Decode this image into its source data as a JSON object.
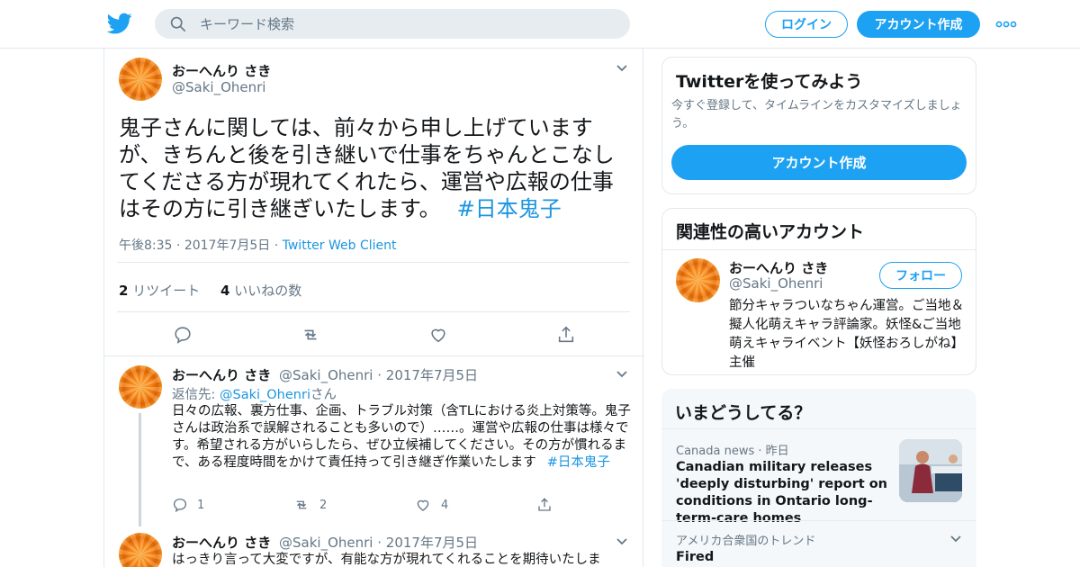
{
  "nav": {
    "search_placeholder": "キーワード検索",
    "login_label": "ログイン",
    "signup_label": "アカウント作成",
    "brand_color": "#1da1f2"
  },
  "main_tweet": {
    "display_name": "おーへんり さき",
    "handle": "@Saki_Ohenri",
    "text": "鬼子さんに関しては、前々から申し上げていますが、きちんと後を引き継いで仕事をちゃんとこなしてくださる方が現れてくれたら、運営や広報の仕事はその方に引き継ぎいたします。",
    "hashtag": "#日本鬼子",
    "time": "午後8:35",
    "date": "2017年7月5日",
    "client": "Twitter Web Client",
    "retweet_count": "2",
    "retweet_label": "リツイート",
    "like_count": "4",
    "like_label": "いいねの数"
  },
  "replies": [
    {
      "display_name": "おーへんり さき",
      "handle": "@Saki_Ohenri",
      "date": "2017年7月5日",
      "reply_to_prefix": "返信先: ",
      "reply_to_mention": "@Saki_Ohenri",
      "reply_to_suffix": "さん",
      "text": "日々の広報、裏方仕事、企画、トラブル対策（含TLにおける炎上対策等。鬼子さんは政治系で誤解されることも多いので）……。運営や広報の仕事は様々です。希望される方がいらしたら、ぜひ立候補してください。その方が慣れるまで、ある程度時間をかけて責任持って引き継ぎ作業いたします",
      "hashtag": "#日本鬼子",
      "reply_count": "1",
      "retweet_count": "2",
      "like_count": "4"
    },
    {
      "display_name": "おーへんり さき",
      "handle": "@Saki_Ohenri",
      "date": "2017年7月5日",
      "text": "はっきり言って大変ですが、有能な方が現れてくれることを期待いたしま"
    }
  ],
  "sidebar": {
    "signup_card": {
      "title": "Twitterを使ってみよう",
      "subtitle": "今すぐ登録して、タイムラインをカスタマイズしましょう。",
      "button": "アカウント作成"
    },
    "related_card": {
      "title": "関連性の高いアカウント",
      "display_name": "おーへんり さき",
      "handle": "@Saki_Ohenri",
      "follow_label": "フォロー",
      "bio": "節分キャラついなちゃん運営。ご当地＆擬人化萌えキャラ評論家。妖怪&ご当地萌えキャライベント【妖怪おろしがね】主催"
    },
    "trends_card": {
      "title": "いまどうしてる？",
      "items": [
        {
          "source": "Canada news",
          "time": "昨日",
          "headline": "Canadian military releases 'deeply disturbing' report on conditions in Ontario long-term-care homes"
        },
        {
          "source": "アメリカ合衆国のトレンド",
          "headline": "Fired"
        }
      ]
    }
  }
}
